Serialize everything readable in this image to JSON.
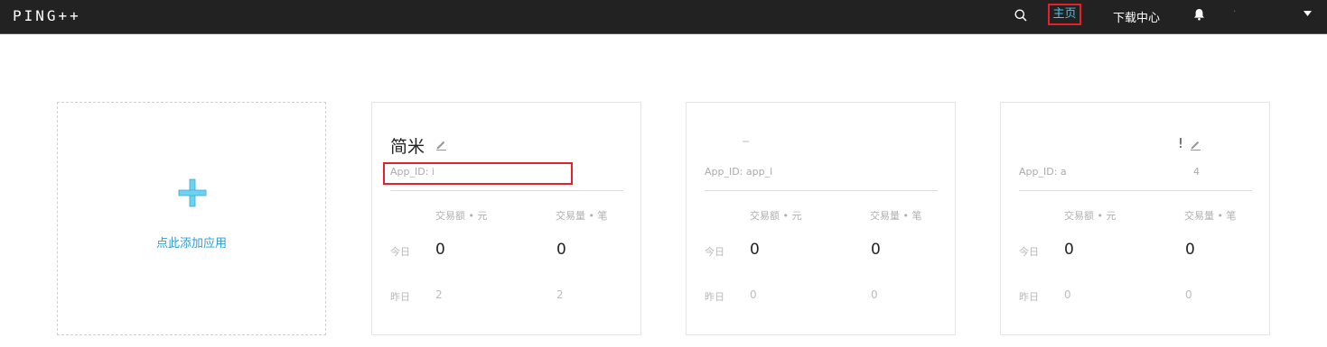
{
  "header": {
    "logo": "PING++",
    "nav_home": "主页",
    "nav_download": "下载中心",
    "user_name": "·"
  },
  "add_card": {
    "label": "点此添加应用"
  },
  "apps": [
    {
      "name": "简米",
      "app_id": "App_ID: i",
      "col_amount": "交易额 • 元",
      "col_count": "交易量 • 笔",
      "today_label": "今日",
      "today_amount": "0",
      "today_count": "0",
      "yesterday_label": "昨日",
      "yesterday_amount": "2",
      "yesterday_count": "2"
    },
    {
      "name": "_",
      "app_id": "App_ID: app_l",
      "col_amount": "交易额 • 元",
      "col_count": "交易量 • 笔",
      "today_label": "今日",
      "today_amount": "0",
      "today_count": "0",
      "yesterday_label": "昨日",
      "yesterday_amount": "0",
      "yesterday_count": "0"
    },
    {
      "name": "!",
      "app_id": "App_ID: a",
      "app_id_tail": "4",
      "col_amount": "交易额 • 元",
      "col_count": "交易量 • 笔",
      "today_label": "今日",
      "today_amount": "0",
      "today_count": "0",
      "yesterday_label": "昨日",
      "yesterday_amount": "0",
      "yesterday_count": "0"
    }
  ],
  "colors": {
    "topbar": "#222222",
    "accent": "#4cc3e8",
    "link": "#2a9fd6",
    "highlight": "#e6202a"
  }
}
